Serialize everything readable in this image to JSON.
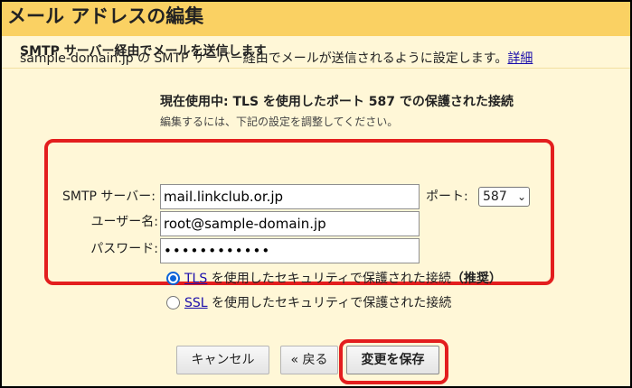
{
  "dialog": {
    "title": "メール アドレスの編集",
    "subheader": "SMTP サーバー経由でメールを送信します",
    "description": "sample-domain.jp の SMTP サーバー経由でメールが送信されるように設定します。",
    "details_link": "詳細",
    "status": "現在使用中: TLS を使用したポート 587 での保護された接続",
    "hint": "編集するには、下記の設定を調整してください。"
  },
  "form": {
    "smtp_label": "SMTP サーバー:",
    "smtp_value": "mail.linkclub.or.jp",
    "port_label": "ポート:",
    "port_value": "587",
    "username_label": "ユーザー名:",
    "username_value": "root@sample-domain.jp",
    "password_label": "パスワード:",
    "password_value": "••••••••••••",
    "tls_link": "TLS",
    "tls_text": "を使用したセキュリティで保護された接続",
    "tls_recommended": "（推奨）",
    "ssl_link": "SSL",
    "ssl_text": "を使用したセキュリティで保護された接続",
    "selected_security": "TLS"
  },
  "buttons": {
    "cancel": "キャンセル",
    "back": "« 戻る",
    "save": "変更を保存"
  },
  "colors": {
    "title_bar": "#fad163",
    "panel": "#fff7d7",
    "highlight": "#e31e1e",
    "link": "#1a0dab"
  }
}
